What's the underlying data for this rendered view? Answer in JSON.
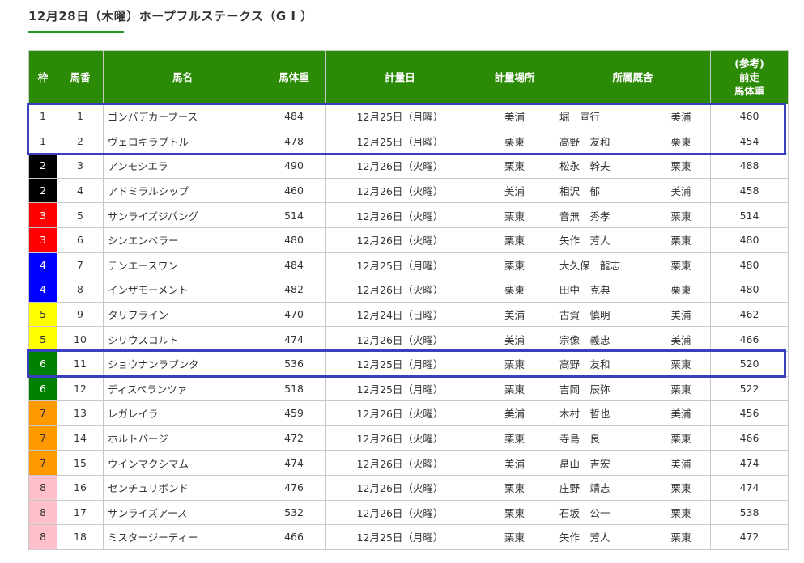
{
  "title": "12月28日（木曜）ホープフルステークス（G I ）",
  "headers": {
    "frame": "枠",
    "number": "馬番",
    "name": "馬名",
    "weight": "馬体重",
    "date": "計量日",
    "place": "計量場所",
    "trainer": "所属厩舎",
    "prev_line1": "(参考)",
    "prev_line2": "前走",
    "prev_line3": "馬体重"
  },
  "frame_colors": {
    "1": {
      "bg": "#ffffff",
      "fg": "#333333"
    },
    "2": {
      "bg": "#000000",
      "fg": "#ffffff"
    },
    "3": {
      "bg": "#ff0000",
      "fg": "#ffffff"
    },
    "4": {
      "bg": "#0000ff",
      "fg": "#ffffff"
    },
    "5": {
      "bg": "#ffff00",
      "fg": "#333333"
    },
    "6": {
      "bg": "#008000",
      "fg": "#ffffff"
    },
    "7": {
      "bg": "#ff9900",
      "fg": "#333333"
    },
    "8": {
      "bg": "#ffc0cb",
      "fg": "#333333"
    }
  },
  "highlight_color": "#3a3fc0",
  "highlighted_rows": [
    [
      1,
      2
    ],
    [
      11,
      11
    ]
  ],
  "rows": [
    {
      "frame": "1",
      "num": "1",
      "name": "ゴンバデカーブース",
      "weight": "484",
      "date": "12月25日（月曜）",
      "place": "美浦",
      "trainer": "堀　宣行",
      "stable": "美浦",
      "prev": "460"
    },
    {
      "frame": "1",
      "num": "2",
      "name": "ヴェロキラプトル",
      "weight": "478",
      "date": "12月25日（月曜）",
      "place": "栗東",
      "trainer": "高野　友和",
      "stable": "栗東",
      "prev": "454"
    },
    {
      "frame": "2",
      "num": "3",
      "name": "アンモシエラ",
      "weight": "490",
      "date": "12月26日（火曜）",
      "place": "栗東",
      "trainer": "松永　幹夫",
      "stable": "栗東",
      "prev": "488"
    },
    {
      "frame": "2",
      "num": "4",
      "name": "アドミラルシップ",
      "weight": "460",
      "date": "12月26日（火曜）",
      "place": "美浦",
      "trainer": "相沢　郁",
      "stable": "美浦",
      "prev": "458"
    },
    {
      "frame": "3",
      "num": "5",
      "name": "サンライズジパング",
      "weight": "514",
      "date": "12月26日（火曜）",
      "place": "栗東",
      "trainer": "音無　秀孝",
      "stable": "栗東",
      "prev": "514"
    },
    {
      "frame": "3",
      "num": "6",
      "name": "シンエンペラー",
      "weight": "480",
      "date": "12月26日（火曜）",
      "place": "栗東",
      "trainer": "矢作　芳人",
      "stable": "栗東",
      "prev": "480"
    },
    {
      "frame": "4",
      "num": "7",
      "name": "テンエースワン",
      "weight": "484",
      "date": "12月25日（月曜）",
      "place": "栗東",
      "trainer": "大久保　龍志",
      "stable": "栗東",
      "prev": "480"
    },
    {
      "frame": "4",
      "num": "8",
      "name": "インザモーメント",
      "weight": "482",
      "date": "12月26日（火曜）",
      "place": "栗東",
      "trainer": "田中　克典",
      "stable": "栗東",
      "prev": "480"
    },
    {
      "frame": "5",
      "num": "9",
      "name": "タリフライン",
      "weight": "470",
      "date": "12月24日（日曜）",
      "place": "美浦",
      "trainer": "古賀　慎明",
      "stable": "美浦",
      "prev": "462"
    },
    {
      "frame": "5",
      "num": "10",
      "name": "シリウスコルト",
      "weight": "474",
      "date": "12月26日（火曜）",
      "place": "美浦",
      "trainer": "宗像　義忠",
      "stable": "美浦",
      "prev": "466"
    },
    {
      "frame": "6",
      "num": "11",
      "name": "ショウナンラプンタ",
      "weight": "536",
      "date": "12月25日（月曜）",
      "place": "栗東",
      "trainer": "高野　友和",
      "stable": "栗東",
      "prev": "520"
    },
    {
      "frame": "6",
      "num": "12",
      "name": "ディスペランツァ",
      "weight": "518",
      "date": "12月25日（月曜）",
      "place": "栗東",
      "trainer": "吉岡　辰弥",
      "stable": "栗東",
      "prev": "522"
    },
    {
      "frame": "7",
      "num": "13",
      "name": "レガレイラ",
      "weight": "459",
      "date": "12月26日（火曜）",
      "place": "美浦",
      "trainer": "木村　哲也",
      "stable": "美浦",
      "prev": "456"
    },
    {
      "frame": "7",
      "num": "14",
      "name": "ホルトバージ",
      "weight": "472",
      "date": "12月26日（火曜）",
      "place": "栗東",
      "trainer": "寺島　良",
      "stable": "栗東",
      "prev": "466"
    },
    {
      "frame": "7",
      "num": "15",
      "name": "ウインマクシマム",
      "weight": "474",
      "date": "12月26日（火曜）",
      "place": "美浦",
      "trainer": "畠山　吉宏",
      "stable": "美浦",
      "prev": "474"
    },
    {
      "frame": "8",
      "num": "16",
      "name": "センチュリボンド",
      "weight": "476",
      "date": "12月26日（火曜）",
      "place": "栗東",
      "trainer": "庄野　靖志",
      "stable": "栗東",
      "prev": "474"
    },
    {
      "frame": "8",
      "num": "17",
      "name": "サンライズアース",
      "weight": "532",
      "date": "12月26日（火曜）",
      "place": "栗東",
      "trainer": "石坂　公一",
      "stable": "栗東",
      "prev": "538"
    },
    {
      "frame": "8",
      "num": "18",
      "name": "ミスタージーティー",
      "weight": "466",
      "date": "12月25日（月曜）",
      "place": "栗東",
      "trainer": "矢作　芳人",
      "stable": "栗東",
      "prev": "472"
    }
  ]
}
